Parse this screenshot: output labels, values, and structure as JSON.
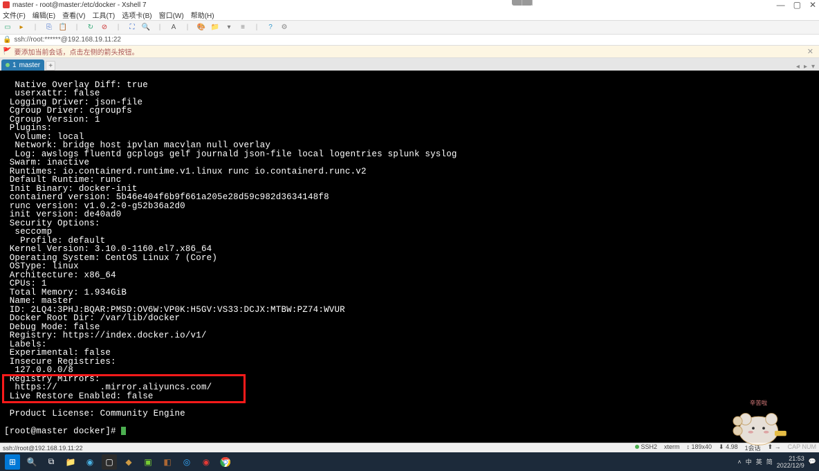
{
  "window": {
    "title": "master - root@master:/etc/docker - Xshell 7"
  },
  "menu": {
    "items": [
      "文件(F)",
      "编辑(E)",
      "查看(V)",
      "工具(T)",
      "选项卡(B)",
      "窗口(W)",
      "帮助(H)"
    ]
  },
  "addressbar": {
    "text": "ssh://root:******@192.168.19.11:22"
  },
  "hint": {
    "text": "要添加当前会话，点击左侧的箭头按钮。"
  },
  "tabs": {
    "items": [
      {
        "index": "1",
        "label": "master"
      }
    ]
  },
  "terminal": {
    "lines": [
      "  Native Overlay Diff: true",
      "  userxattr: false",
      " Logging Driver: json-file",
      " Cgroup Driver: cgroupfs",
      " Cgroup Version: 1",
      " Plugins:",
      "  Volume: local",
      "  Network: bridge host ipvlan macvlan null overlay",
      "  Log: awslogs fluentd gcplogs gelf journald json-file local logentries splunk syslog",
      " Swarm: inactive",
      " Runtimes: io.containerd.runtime.v1.linux runc io.containerd.runc.v2",
      " Default Runtime: runc",
      " Init Binary: docker-init",
      " containerd version: 5b46e404f6b9f661a205e28d59c982d3634148f8",
      " runc version: v1.0.2-0-g52b36a2d0",
      " init version: de40ad0",
      " Security Options:",
      "  seccomp",
      "   Profile: default",
      " Kernel Version: 3.10.0-1160.el7.x86_64",
      " Operating System: CentOS Linux 7 (Core)",
      " OSType: linux",
      " Architecture: x86_64",
      " CPUs: 1",
      " Total Memory: 1.934GiB",
      " Name: master",
      " ID: 2LQ4:3PHJ:BQAR:PMSD:OV6W:VP0K:H5GV:VS33:DCJX:MTBW:PZ74:WVUR",
      " Docker Root Dir: /var/lib/docker",
      " Debug Mode: false",
      " Registry: https://index.docker.io/v1/",
      " Labels:",
      " Experimental: false",
      " Insecure Registries:",
      "  127.0.0.0/8",
      " Registry Mirrors:",
      "  https://        .mirror.aliyuncs.com/",
      " Live Restore Enabled: false",
      "",
      " Product License: Community Engine",
      ""
    ],
    "prompt": "[root@master docker]# "
  },
  "statusbar": {
    "left": "ssh://root@192.168.19.11:22",
    "items": [
      "SSH2",
      "xterm",
      "↕ 189x40",
      "⬇ 4.98",
      "",
      "1会话",
      "⬆ →",
      "CAP  NUM"
    ]
  },
  "tray": {
    "lang_a": "中",
    "lang_b": "英",
    "ime": "简",
    "time": "21:53",
    "date": "2022/12/9"
  },
  "mascot_label": "辛苦啦"
}
